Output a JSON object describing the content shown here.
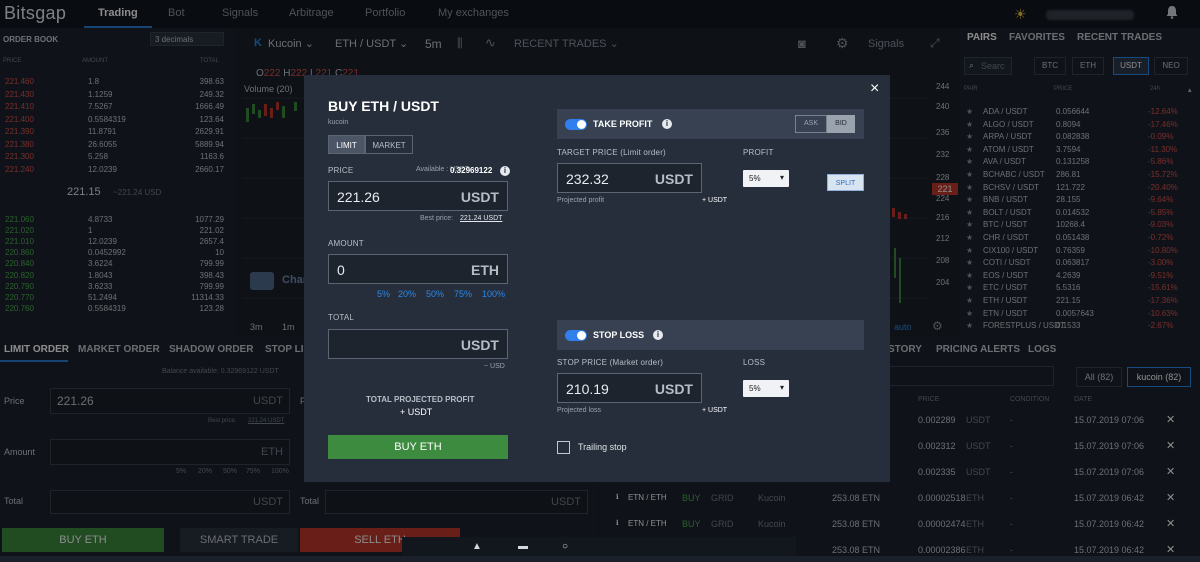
{
  "topnav": {
    "brand": "Bitsgap",
    "items": [
      "Trading",
      "Bot",
      "Signals",
      "Arbitrage",
      "Portfolio",
      "My exchanges"
    ]
  },
  "orderbook": {
    "title": "ORDER BOOK",
    "decimals": "3 decimals",
    "headers": [
      "PRICE",
      "AMOUNT",
      "TOTAL"
    ],
    "asks": [
      [
        "221.460",
        "1.8",
        "398.63"
      ],
      [
        "221.430",
        "1.1259",
        "249.32"
      ],
      [
        "221.410",
        "7.5267",
        "1666.49"
      ],
      [
        "221.400",
        "0.5584319",
        "123.64"
      ],
      [
        "221.390",
        "11.8791",
        "2629.91"
      ],
      [
        "221.380",
        "26.6055",
        "5889.94"
      ],
      [
        "221.300",
        "5.258",
        "1163.6"
      ],
      [
        "221.240",
        "12.0239",
        "2660.17"
      ]
    ],
    "mid_price": "221.15",
    "mid_usd": "~221.24 USD",
    "bids": [
      [
        "221.060",
        "4.8733",
        "1077.29"
      ],
      [
        "221.020",
        "1",
        "221.02"
      ],
      [
        "221.010",
        "12.0239",
        "2657.4"
      ],
      [
        "220.860",
        "0.0452992",
        "10"
      ],
      [
        "220.840",
        "3.6224",
        "799.99"
      ],
      [
        "220.820",
        "1.8043",
        "398.43"
      ],
      [
        "220.790",
        "3.6233",
        "799.99"
      ],
      [
        "220.770",
        "51.2494",
        "11314.33"
      ],
      [
        "220.760",
        "0.5584319",
        "123.28"
      ]
    ]
  },
  "chart_toolbar": {
    "exchange": "Kucoin",
    "pair": "ETH / USDT",
    "interval": "5m",
    "recent_trades": "RECENT TRADES",
    "signals": "Signals",
    "ohlc_o": "O",
    "ohlc_o_val": "222",
    "ohlc_h": "H",
    "ohlc_h_val": "222",
    "ohlc_l": "L",
    "ohlc_l_val": "221",
    "ohlc_c": "C",
    "ohlc_c_val": "221",
    "volume": "Volume (20)",
    "price_axis": [
      "244",
      "240",
      "236",
      "232",
      "228",
      "224",
      "221",
      "216",
      "212",
      "208",
      "204"
    ],
    "last_price_tag": "221",
    "timeframes": [
      "3m",
      "1m"
    ],
    "auto": "auto",
    "watermark": "Char"
  },
  "pairs": {
    "tabs": [
      "PAIRS",
      "FAVORITES",
      "RECENT TRADES"
    ],
    "search_placeholder": "Searc",
    "quote_buttons": [
      "BTC",
      "ETH",
      "USDT",
      "NEO"
    ],
    "headers": [
      "PAIR",
      "PRICE",
      "24h"
    ],
    "rows": [
      [
        "ADA / USDT",
        "0.056644",
        "-12.64%"
      ],
      [
        "ALGO / USDT",
        "0.8094",
        "-17.46%"
      ],
      [
        "ARPA / USDT",
        "0.082838",
        "-0.09%"
      ],
      [
        "ATOM / USDT",
        "3.7594",
        "-11.30%"
      ],
      [
        "AVA / USDT",
        "0.131258",
        "-5.86%"
      ],
      [
        "BCHABC / USDT",
        "286.81",
        "-15.72%"
      ],
      [
        "BCHSV / USDT",
        "121.722",
        "-20.40%"
      ],
      [
        "BNB / USDT",
        "28.155",
        "-9.64%"
      ],
      [
        "BOLT / USDT",
        "0.014532",
        "-5.85%"
      ],
      [
        "BTC / USDT",
        "10268.4",
        "-9.03%"
      ],
      [
        "CHR / USDT",
        "0.051438",
        "-0.72%"
      ],
      [
        "CIX100 / USDT",
        "0.76359",
        "-10.80%"
      ],
      [
        "COTI / USDT",
        "0.063817",
        "-3.00%"
      ],
      [
        "EOS / USDT",
        "4.2639",
        "-9.51%"
      ],
      [
        "ETC / USDT",
        "5.5316",
        "-15.61%"
      ],
      [
        "ETH / USDT",
        "221.15",
        "-17.36%"
      ],
      [
        "ETN / USDT",
        "0.0057643",
        "-10.63%"
      ],
      [
        "FORESTPLUS / USDT",
        "0.1533",
        "-2.67%"
      ]
    ]
  },
  "bottom_tabs": [
    "LIMIT ORDER",
    "MARKET ORDER",
    "SHADOW ORDER",
    "STOP LIM"
  ],
  "bottom_form": {
    "balance": "Balance available: 0.32969122 USDT",
    "price_label": "Price",
    "price_value": "221.26",
    "price_unit": "USDT",
    "best_price": "Best price:",
    "best_price_val": "221.24 USDT",
    "amount_label": "Amount",
    "amount_unit": "ETH",
    "pcts": [
      "5%",
      "20%",
      "50%",
      "75%",
      "100%"
    ],
    "total_label": "Total",
    "total_unit": "USDT",
    "buy_btn": "BUY ETH",
    "smart_btn": "SMART TRADE",
    "sell_btn": "SELL ETH",
    "price_label2": "P",
    "total_label2": "Total"
  },
  "history": {
    "tabs": [
      "STORY",
      "PRICING ALERTS",
      "LOGS"
    ],
    "all_btn": "All (82)",
    "kucoin_btn": "kucoin (82)",
    "headers": [
      "PRICE",
      "CONDITION",
      "DATE"
    ],
    "rows": [
      {
        "pair": "",
        "side": "",
        "type": "",
        "exch": "",
        "amount": "",
        "price": "0.002289",
        "unit": "USDT",
        "cond": "-",
        "date": "15.07.2019 07:06"
      },
      {
        "pair": "",
        "side": "",
        "type": "",
        "exch": "",
        "amount": "",
        "price": "0.002312",
        "unit": "USDT",
        "cond": "-",
        "date": "15.07.2019 07:06"
      },
      {
        "pair": "",
        "side": "",
        "type": "",
        "exch": "",
        "amount": "",
        "price": "0.002335",
        "unit": "USDT",
        "cond": "-",
        "date": "15.07.2019 07:06"
      },
      {
        "pair": "ETN / ETH",
        "side": "BUY",
        "type": "GRID",
        "exch": "Kucoin",
        "amount": "253.08 ETN",
        "price": "0.00002518",
        "unit": "ETH",
        "cond": "-",
        "date": "15.07.2019 06:42"
      },
      {
        "pair": "ETN / ETH",
        "side": "BUY",
        "type": "GRID",
        "exch": "Kucoin",
        "amount": "253.08 ETN",
        "price": "0.00002474",
        "unit": "ETH",
        "cond": "-",
        "date": "15.07.2019 06:42"
      },
      {
        "pair": "",
        "side": "",
        "type": "",
        "exch": "",
        "amount": "253.08 ETN",
        "price": "0.00002386",
        "unit": "ETH",
        "cond": "-",
        "date": "15.07.2019 06:42"
      }
    ]
  },
  "modal": {
    "title": "BUY ETH / USDT",
    "exchange": "kucoin",
    "order_types": [
      "LIMIT",
      "MARKET"
    ],
    "price_label": "PRICE",
    "available": "Available : USDT:",
    "available_val": "0.32969122",
    "price_value": "221.26",
    "price_unit": "USDT",
    "best_price": "Best price:",
    "best_price_val": "221.24 USDT",
    "amount_label": "AMOUNT",
    "amount_value": "0",
    "amount_unit": "ETH",
    "pcts": [
      "5%",
      "20%",
      "50%",
      "75%",
      "100%"
    ],
    "total_label": "TOTAL",
    "total_unit": "USDT",
    "total_usd": "~ USD",
    "projected_label": "TOTAL PROJECTED PROFIT",
    "projected_val": "+ USDT",
    "buy_btn": "BUY ETH",
    "take_profit": {
      "title": "TAKE PROFIT",
      "ask": "ASK",
      "bid": "BID",
      "target_label": "TARGET PRICE (Limit order)",
      "profit_label": "PROFIT",
      "target_value": "232.32",
      "target_unit": "USDT",
      "profit_select": "5%",
      "split": "SPLIT",
      "projected": "Projected profit",
      "projected_val": "+ USDT"
    },
    "stop_loss": {
      "title": "STOP LOSS",
      "stop_label": "STOP PRICE (Market order)",
      "loss_label": "LOSS",
      "stop_value": "210.19",
      "stop_unit": "USDT",
      "loss_select": "5%",
      "projected": "Projected loss",
      "projected_val": "+ USDT"
    },
    "trailing": "Trailing stop",
    "close": "×"
  },
  "colors": {
    "accent": "#2f80ed",
    "buy": "#3c8b3f",
    "sell": "#c0392b",
    "red_text": "#d9534f",
    "green_text": "#4caf50"
  }
}
